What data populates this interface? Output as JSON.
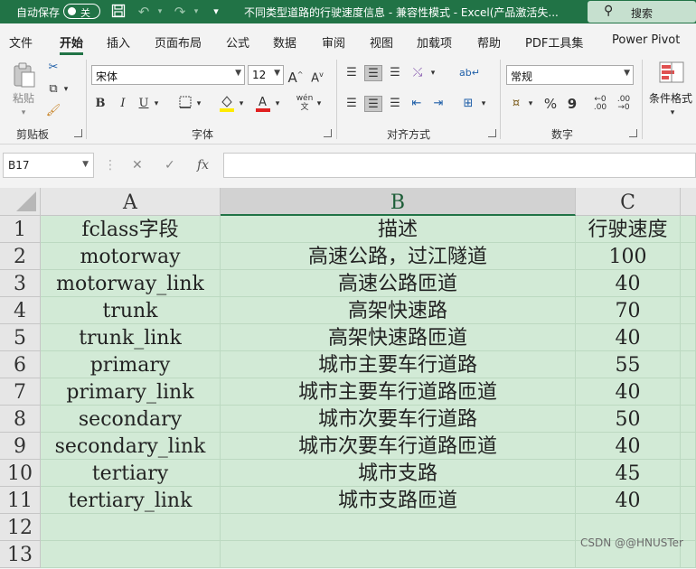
{
  "titlebar": {
    "autosave_label": "自动保存",
    "autosave_state": "关",
    "title": "不同类型道路的行驶速度信息  -  兼容性模式  -  Excel(产品激活失...",
    "search_label": "搜索"
  },
  "tabs": [
    "文件",
    "开始",
    "插入",
    "页面布局",
    "公式",
    "数据",
    "审阅",
    "视图",
    "加载项",
    "帮助",
    "PDF工具集",
    "Power Pivot"
  ],
  "ribbon": {
    "clipboard": {
      "paste_label": "粘贴",
      "group_label": "剪贴板"
    },
    "font": {
      "font_name": "宋体",
      "font_size": "12",
      "bold": "B",
      "italic": "I",
      "underline": "U",
      "grow": "A",
      "shrink": "A",
      "phonetic": "wén",
      "group_label": "字体"
    },
    "alignment": {
      "group_label": "对齐方式"
    },
    "number": {
      "format": "常规",
      "percent": "%",
      "comma": "9",
      "group_label": "数字"
    },
    "styles": {
      "conditional_format": "条件格式"
    }
  },
  "formula_bar": {
    "name_box": "B17",
    "fx": "fx",
    "formula": ""
  },
  "sheet": {
    "columns": [
      "A",
      "B",
      "C"
    ],
    "rows": [
      {
        "num": "1",
        "cells": [
          "fclass字段",
          "描述",
          "行驶速度"
        ]
      },
      {
        "num": "2",
        "cells": [
          "motorway",
          "高速公路，过江隧道",
          "100"
        ]
      },
      {
        "num": "3",
        "cells": [
          "motorway_link",
          "高速公路匝道",
          "40"
        ]
      },
      {
        "num": "4",
        "cells": [
          "trunk",
          "高架快速路",
          "70"
        ]
      },
      {
        "num": "5",
        "cells": [
          "trunk_link",
          "高架快速路匝道",
          "40"
        ]
      },
      {
        "num": "6",
        "cells": [
          "primary",
          "城市主要车行道路",
          "55"
        ]
      },
      {
        "num": "7",
        "cells": [
          "primary_link",
          "城市主要车行道路匝道",
          "40"
        ]
      },
      {
        "num": "8",
        "cells": [
          "secondary",
          "城市次要车行道路",
          "50"
        ]
      },
      {
        "num": "9",
        "cells": [
          "secondary_link",
          "城市次要车行道路匝道",
          "40"
        ]
      },
      {
        "num": "10",
        "cells": [
          "tertiary",
          "城市支路",
          "45"
        ]
      },
      {
        "num": "11",
        "cells": [
          "tertiary_link",
          "城市支路匝道",
          "40"
        ]
      },
      {
        "num": "12",
        "cells": [
          "",
          "",
          ""
        ]
      },
      {
        "num": "13",
        "cells": [
          "",
          "",
          ""
        ]
      }
    ]
  },
  "watermark": "CSDN @@HNUSTer"
}
